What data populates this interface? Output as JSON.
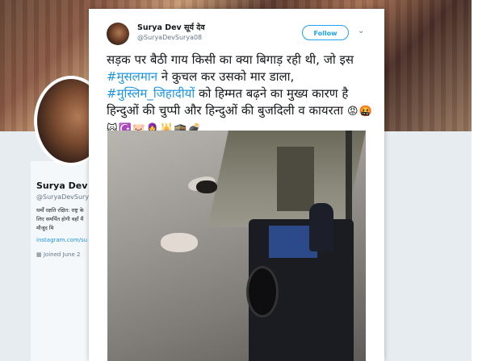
{
  "background_profile": {
    "name": "Surya Dev",
    "handle": "@SuryaDevSurya",
    "bio": "धर्मों रक्षति रक्षित: राष्ट्र के लिए समर्पित होगी वहाँ मैं मौजूद मि",
    "link": "instagram.com/su",
    "joined": "Joined June 2"
  },
  "tweet": {
    "author_name": "Surya Dev सूर्य देव",
    "author_handle": "@SuryaDevSurya08",
    "follow_label": "Follow",
    "caret_icon": "chevron-down-icon",
    "text_part1": "सड़क पर बैठी गाय किसी का क्या बिगाड़ रही थी, जो इस ",
    "hashtag1": "#मुसलमान",
    "text_part2": " ने कुचल कर उसको मार डाला, ",
    "hashtag2": "#मुस्लिम_जिहादीयों",
    "text_part3": " को हिम्मत बढ़ने का मुख्य कारण है हिन्दुओं की चुप्पी और हिन्दुओं की बुजदिली व कायरता ",
    "emojis": "😡🤬🙀☪️🐷🧕🕌🕋💣"
  },
  "colors": {
    "accent": "#1da1f2",
    "link": "#1b95e0",
    "text": "#14171a",
    "muted": "#657786"
  }
}
